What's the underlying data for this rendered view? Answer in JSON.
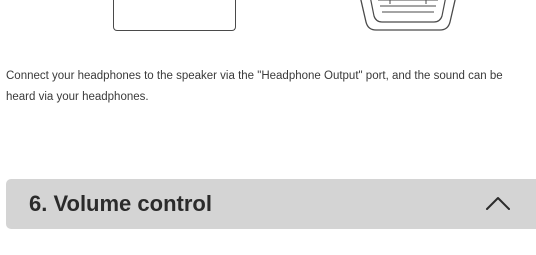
{
  "content": {
    "description": "Connect your headphones to the speaker via the \"Headphone Output\" port, and the sound can be heard via your headphones."
  },
  "section": {
    "title": "6. Volume control",
    "expanded": true,
    "toggle_icon": "chevron-up-icon"
  },
  "colors": {
    "header_background": "#d4d4d4",
    "text": "#3a3a3a",
    "title_text": "#2b2b2b",
    "illustration_stroke": "#4a4a4a"
  }
}
